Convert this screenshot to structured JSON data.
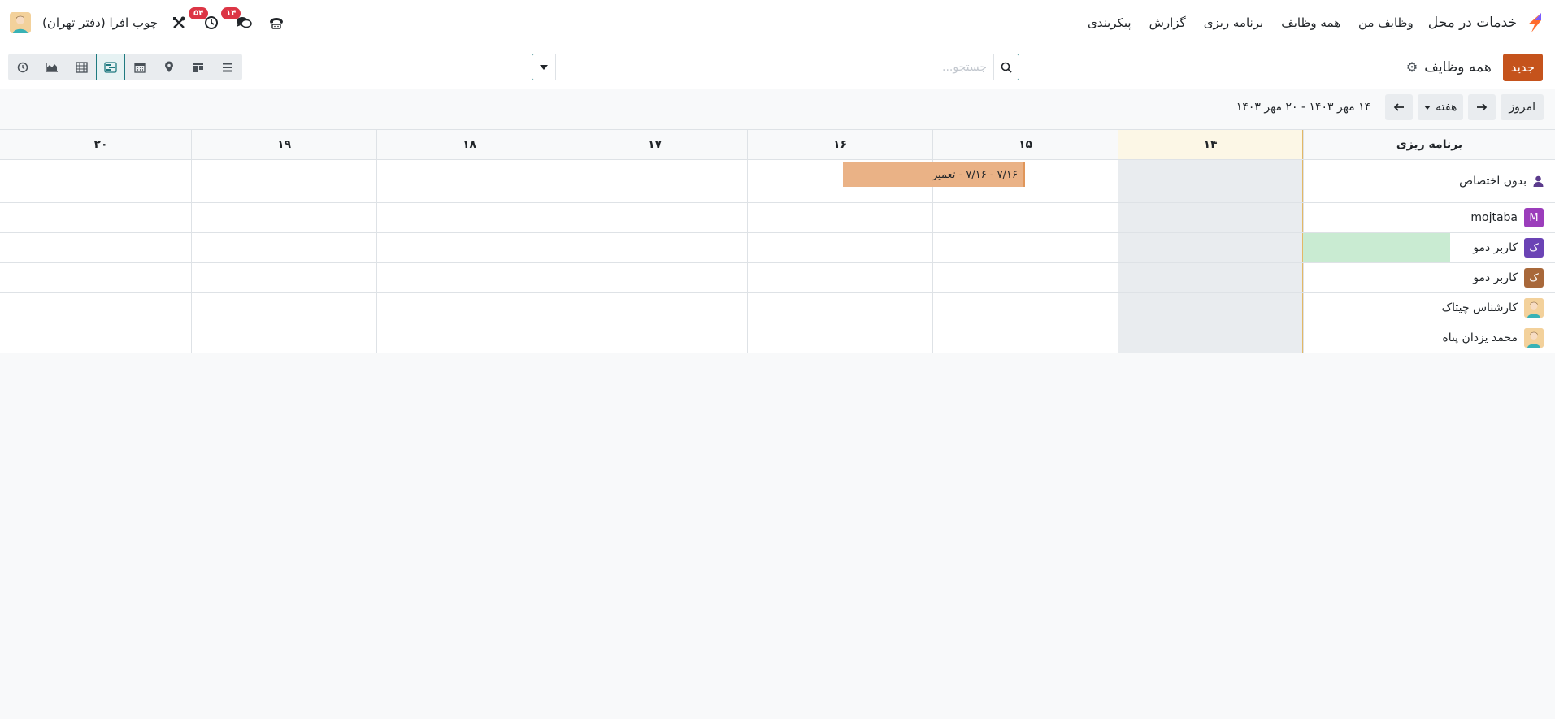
{
  "nav": {
    "app_name": "خدمات در محل",
    "menu": [
      "وظایف من",
      "همه وظایف",
      "برنامه ریزی",
      "گزارش",
      "پیکربندی"
    ],
    "messages_badge": "۱۴",
    "activities_badge": "۵۴",
    "company": "چوب افرا (دفتر تهران)"
  },
  "control": {
    "new_label": "جدید",
    "view_title": "همه وظایف",
    "search_placeholder": "جستجو...",
    "views": [
      "list-view-icon",
      "kanban-view-icon",
      "map-view-icon",
      "calendar-view-icon",
      "gantt-view-icon",
      "pivot-view-icon",
      "graph-view-icon",
      "activity-view-icon"
    ],
    "active_view": "gantt-view-icon"
  },
  "toolbar": {
    "today_label": "امروز",
    "scale_label": "هفته",
    "date_range": "۱۴ مهر ۱۴۰۳ - ۲۰ مهر ۱۴۰۳"
  },
  "gantt": {
    "row_header": "برنامه ریزی",
    "days": [
      "۱۴",
      "۱۵",
      "۱۶",
      "۱۷",
      "۱۸",
      "۱۹",
      "۲۰"
    ],
    "today_index": 0,
    "rows": [
      {
        "label": "بدون اختصاص",
        "avatar": "person-icon"
      },
      {
        "label": "mojtaba",
        "avatar_letter": "M",
        "avatar_color": "#9b3dbb"
      },
      {
        "label": "کاربر دمو",
        "avatar_letter": "ک",
        "avatar_color": "#6b43b5"
      },
      {
        "label": "کاربر دمو",
        "avatar_letter": "ک",
        "avatar_color": "#a8683a"
      },
      {
        "label": "کارشناس چیتاک",
        "avatar": "photo"
      },
      {
        "label": "محمد یزدان پناه",
        "avatar": "photo"
      }
    ],
    "pill": {
      "text": "۷/۱۶ - ۷/۱۶ - تعمیر",
      "color": "#eab286"
    }
  }
}
